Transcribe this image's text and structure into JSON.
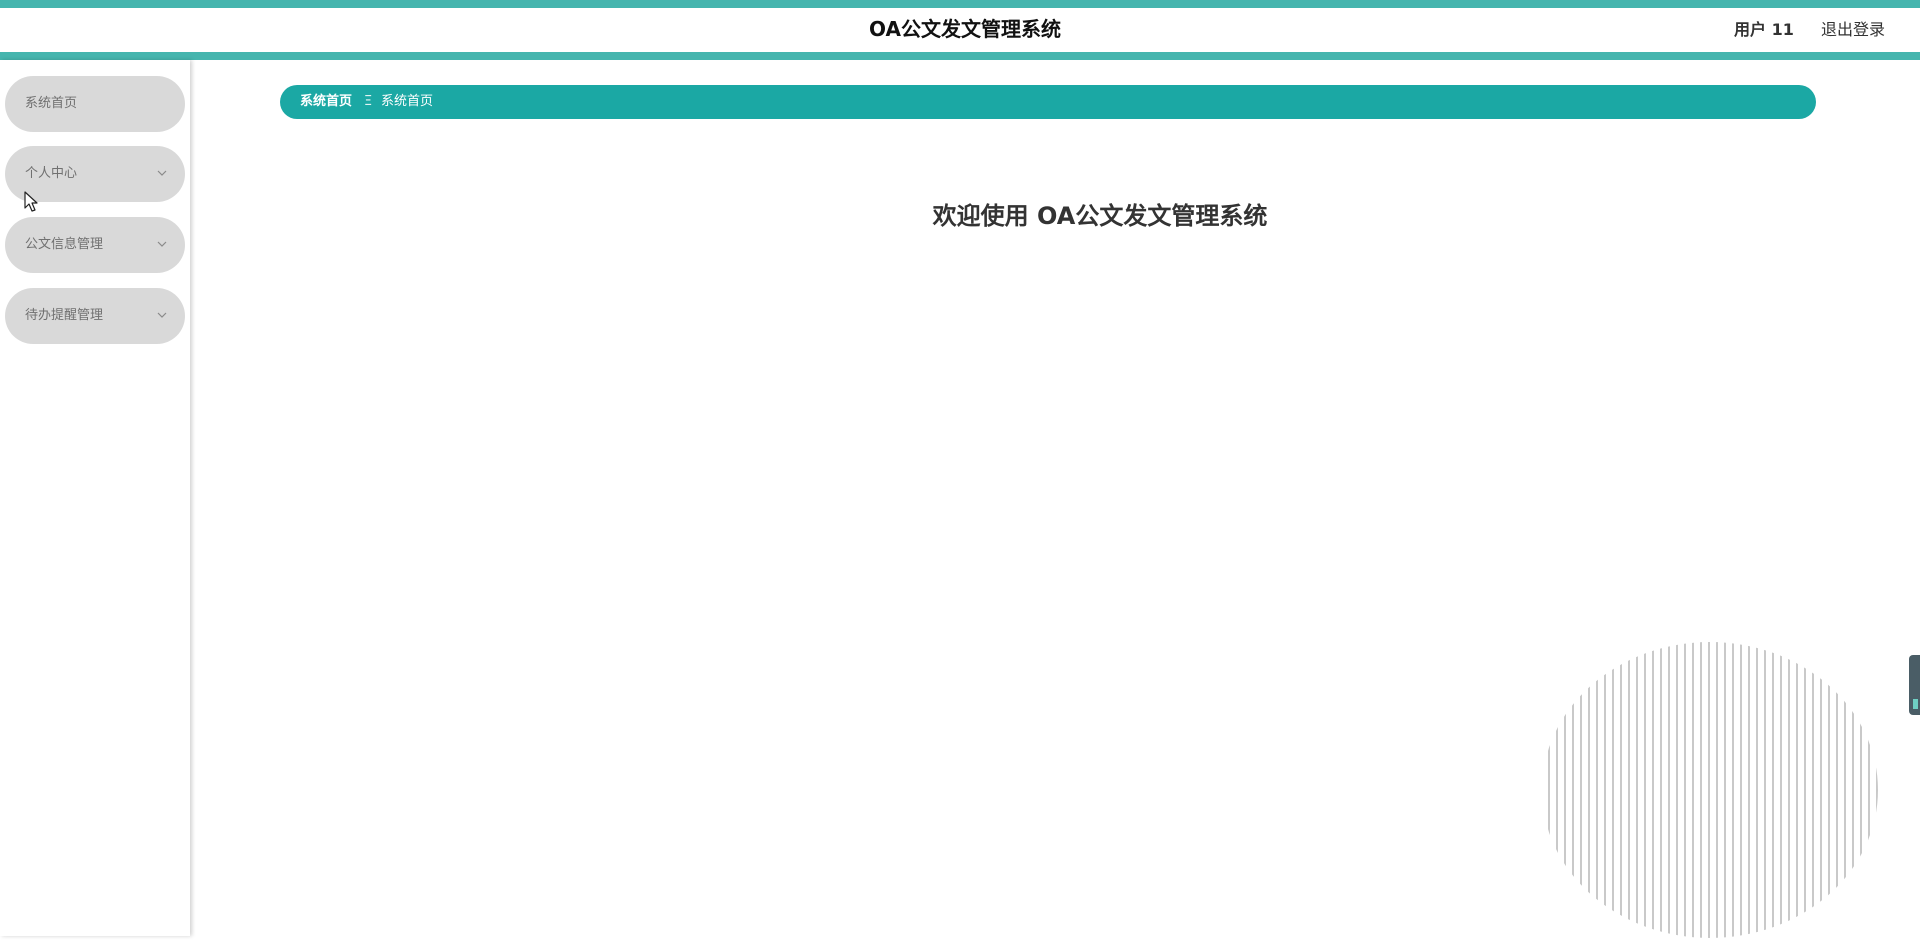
{
  "header": {
    "title": "OA公文发文管理系统",
    "user_label": "用户 11",
    "logout_label": "退出登录"
  },
  "sidebar": {
    "items": [
      {
        "label": "系统首页",
        "has_submenu": false
      },
      {
        "label": "个人中心",
        "has_submenu": true
      },
      {
        "label": "公文信息管理",
        "has_submenu": true
      },
      {
        "label": "待办提醒管理",
        "has_submenu": true
      }
    ]
  },
  "breadcrumb": {
    "home": "系统首页",
    "separator": "Ξ",
    "current": "系统首页"
  },
  "main": {
    "welcome": "欢迎使用 OA公文发文管理系统"
  },
  "colors": {
    "accent": "#45b5ae",
    "breadcrumb_bg": "#1ba8a4",
    "menu_bg": "#d9d9d9"
  },
  "icons": {
    "chevron": "chevron-down-icon",
    "decoration": "striped-circle-decoration",
    "cursor": "mouse-cursor-icon"
  }
}
